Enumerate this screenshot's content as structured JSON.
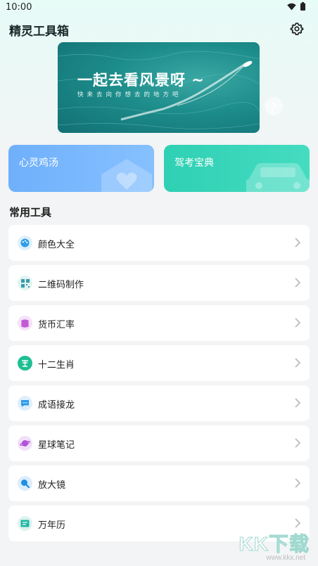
{
  "status": {
    "time": "10:00"
  },
  "app": {
    "title": "精灵工具箱"
  },
  "banner": {
    "headline": "一起去看风景呀 ~",
    "subtitle": "快来去向你想去的地方吧"
  },
  "cards": [
    {
      "label": "心灵鸡汤",
      "color": "#74b4fc"
    },
    {
      "label": "驾考宝典",
      "color": "#36d4b8"
    }
  ],
  "section": {
    "title": "常用工具"
  },
  "tools": [
    {
      "label": "颜色大全",
      "icon": "palette-icon",
      "color": "#2f9de8"
    },
    {
      "label": "二维码制作",
      "icon": "qrcode-icon",
      "color": "#3a9aa8"
    },
    {
      "label": "货币汇率",
      "icon": "coins-icon",
      "color": "#c25ad6"
    },
    {
      "label": "十二生肖",
      "icon": "zodiac-icon",
      "color": "#1fbf93"
    },
    {
      "label": "成语接龙",
      "icon": "chat-icon",
      "color": "#2d9ae8"
    },
    {
      "label": "星球笔记",
      "icon": "planet-icon",
      "color": "#b251d8"
    },
    {
      "label": "放大镜",
      "icon": "magnifier-icon",
      "color": "#1f8fe6"
    },
    {
      "label": "万年历",
      "icon": "calendar-icon",
      "color": "#1fb6a4"
    }
  ],
  "watermark": {
    "brand": "KK下载",
    "url": "www.kkx.net"
  }
}
